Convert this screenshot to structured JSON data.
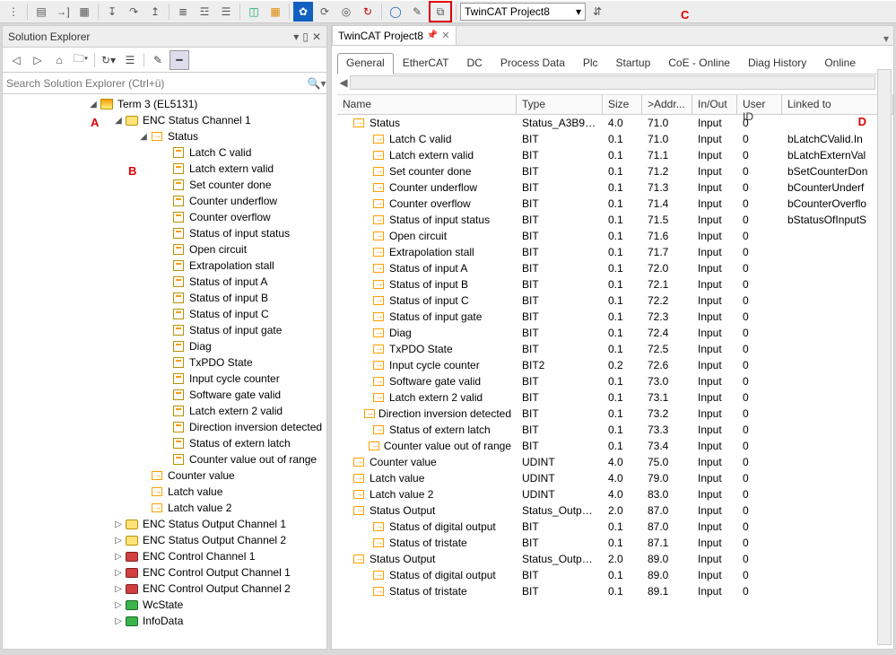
{
  "toolbar": {
    "project_combo": "TwinCAT Project8",
    "annot_c": "C"
  },
  "solution_explorer": {
    "title": "Solution Explorer",
    "search_placeholder": "Search Solution Explorer (Ctrl+ü)",
    "annot_a": "A",
    "annot_b": "B"
  },
  "tree": {
    "term": "Term 3 (EL5131)",
    "enc_status_ch1": "ENC Status Channel 1",
    "status": "Status",
    "status_children": [
      "Latch C valid",
      "Latch extern valid",
      "Set counter done",
      "Counter underflow",
      "Counter overflow",
      "Status of input status",
      "Open circuit",
      "Extrapolation stall",
      "Status of input A",
      "Status of input B",
      "Status of input C",
      "Status of input gate",
      "Diag",
      "TxPDO State",
      "Input cycle counter",
      "Software gate valid",
      "Latch extern 2 valid",
      "Direction inversion detected",
      "Status of extern latch",
      "Counter value out of range"
    ],
    "counter_value": "Counter value",
    "latch_value": "Latch value",
    "latch_value2": "Latch value 2",
    "enc_status_out1": "ENC Status Output Channel 1",
    "enc_status_out2": "ENC Status Output Channel 2",
    "enc_control1": "ENC Control Channel 1",
    "enc_control_out1": "ENC Control Output Channel 1",
    "enc_control_out2": "ENC Control Output Channel 2",
    "wcstate": "WcState",
    "infodata": "InfoData"
  },
  "editor": {
    "tab_title": "TwinCAT Project8",
    "tabs": [
      "General",
      "EtherCAT",
      "DC",
      "Process Data",
      "Plc",
      "Startup",
      "CoE - Online",
      "Diag History",
      "Online"
    ],
    "active_tab": "General",
    "annot_d": "D",
    "columns": [
      "Name",
      "Type",
      "Size",
      ">Addr...",
      "In/Out",
      "User ID",
      "Linked to"
    ],
    "rows": [
      {
        "lvl": 0,
        "name": "Status",
        "type": "Status_A3B90...",
        "size": "4.0",
        "addr": "71.0",
        "io": "Input",
        "uid": "0",
        "link": ""
      },
      {
        "lvl": 1,
        "name": "Latch C valid",
        "type": "BIT",
        "size": "0.1",
        "addr": "71.0",
        "io": "Input",
        "uid": "0",
        "link": "bLatchCValid.In"
      },
      {
        "lvl": 1,
        "name": "Latch extern valid",
        "type": "BIT",
        "size": "0.1",
        "addr": "71.1",
        "io": "Input",
        "uid": "0",
        "link": "bLatchExternVal"
      },
      {
        "lvl": 1,
        "name": "Set counter done",
        "type": "BIT",
        "size": "0.1",
        "addr": "71.2",
        "io": "Input",
        "uid": "0",
        "link": "bSetCounterDon"
      },
      {
        "lvl": 1,
        "name": "Counter underflow",
        "type": "BIT",
        "size": "0.1",
        "addr": "71.3",
        "io": "Input",
        "uid": "0",
        "link": "bCounterUnderf"
      },
      {
        "lvl": 1,
        "name": "Counter overflow",
        "type": "BIT",
        "size": "0.1",
        "addr": "71.4",
        "io": "Input",
        "uid": "0",
        "link": "bCounterOverflo"
      },
      {
        "lvl": 1,
        "name": "Status of input status",
        "type": "BIT",
        "size": "0.1",
        "addr": "71.5",
        "io": "Input",
        "uid": "0",
        "link": "bStatusOfInputS"
      },
      {
        "lvl": 1,
        "name": "Open circuit",
        "type": "BIT",
        "size": "0.1",
        "addr": "71.6",
        "io": "Input",
        "uid": "0",
        "link": ""
      },
      {
        "lvl": 1,
        "name": "Extrapolation stall",
        "type": "BIT",
        "size": "0.1",
        "addr": "71.7",
        "io": "Input",
        "uid": "0",
        "link": ""
      },
      {
        "lvl": 1,
        "name": "Status of input A",
        "type": "BIT",
        "size": "0.1",
        "addr": "72.0",
        "io": "Input",
        "uid": "0",
        "link": ""
      },
      {
        "lvl": 1,
        "name": "Status of input B",
        "type": "BIT",
        "size": "0.1",
        "addr": "72.1",
        "io": "Input",
        "uid": "0",
        "link": ""
      },
      {
        "lvl": 1,
        "name": "Status of input C",
        "type": "BIT",
        "size": "0.1",
        "addr": "72.2",
        "io": "Input",
        "uid": "0",
        "link": ""
      },
      {
        "lvl": 1,
        "name": "Status of input gate",
        "type": "BIT",
        "size": "0.1",
        "addr": "72.3",
        "io": "Input",
        "uid": "0",
        "link": ""
      },
      {
        "lvl": 1,
        "name": "Diag",
        "type": "BIT",
        "size": "0.1",
        "addr": "72.4",
        "io": "Input",
        "uid": "0",
        "link": ""
      },
      {
        "lvl": 1,
        "name": "TxPDO State",
        "type": "BIT",
        "size": "0.1",
        "addr": "72.5",
        "io": "Input",
        "uid": "0",
        "link": ""
      },
      {
        "lvl": 1,
        "name": "Input cycle counter",
        "type": "BIT2",
        "size": "0.2",
        "addr": "72.6",
        "io": "Input",
        "uid": "0",
        "link": ""
      },
      {
        "lvl": 1,
        "name": "Software gate valid",
        "type": "BIT",
        "size": "0.1",
        "addr": "73.0",
        "io": "Input",
        "uid": "0",
        "link": ""
      },
      {
        "lvl": 1,
        "name": "Latch extern 2 valid",
        "type": "BIT",
        "size": "0.1",
        "addr": "73.1",
        "io": "Input",
        "uid": "0",
        "link": ""
      },
      {
        "lvl": 1,
        "name": "Direction inversion detected",
        "type": "BIT",
        "size": "0.1",
        "addr": "73.2",
        "io": "Input",
        "uid": "0",
        "link": ""
      },
      {
        "lvl": 1,
        "name": "Status of extern latch",
        "type": "BIT",
        "size": "0.1",
        "addr": "73.3",
        "io": "Input",
        "uid": "0",
        "link": ""
      },
      {
        "lvl": 1,
        "name": "Counter value out of range",
        "type": "BIT",
        "size": "0.1",
        "addr": "73.4",
        "io": "Input",
        "uid": "0",
        "link": ""
      },
      {
        "lvl": 0,
        "name": "Counter value",
        "type": "UDINT",
        "size": "4.0",
        "addr": "75.0",
        "io": "Input",
        "uid": "0",
        "link": ""
      },
      {
        "lvl": 0,
        "name": "Latch value",
        "type": "UDINT",
        "size": "4.0",
        "addr": "79.0",
        "io": "Input",
        "uid": "0",
        "link": ""
      },
      {
        "lvl": 0,
        "name": "Latch value 2",
        "type": "UDINT",
        "size": "4.0",
        "addr": "83.0",
        "io": "Input",
        "uid": "0",
        "link": ""
      },
      {
        "lvl": 0,
        "name": "Status Output",
        "type": "Status_Output...",
        "size": "2.0",
        "addr": "87.0",
        "io": "Input",
        "uid": "0",
        "link": ""
      },
      {
        "lvl": 1,
        "name": "Status of digital output",
        "type": "BIT",
        "size": "0.1",
        "addr": "87.0",
        "io": "Input",
        "uid": "0",
        "link": ""
      },
      {
        "lvl": 1,
        "name": "Status of tristate",
        "type": "BIT",
        "size": "0.1",
        "addr": "87.1",
        "io": "Input",
        "uid": "0",
        "link": ""
      },
      {
        "lvl": 0,
        "name": "Status Output",
        "type": "Status_Output...",
        "size": "2.0",
        "addr": "89.0",
        "io": "Input",
        "uid": "0",
        "link": ""
      },
      {
        "lvl": 1,
        "name": "Status of digital output",
        "type": "BIT",
        "size": "0.1",
        "addr": "89.0",
        "io": "Input",
        "uid": "0",
        "link": ""
      },
      {
        "lvl": 1,
        "name": "Status of tristate",
        "type": "BIT",
        "size": "0.1",
        "addr": "89.1",
        "io": "Input",
        "uid": "0",
        "link": ""
      }
    ]
  }
}
